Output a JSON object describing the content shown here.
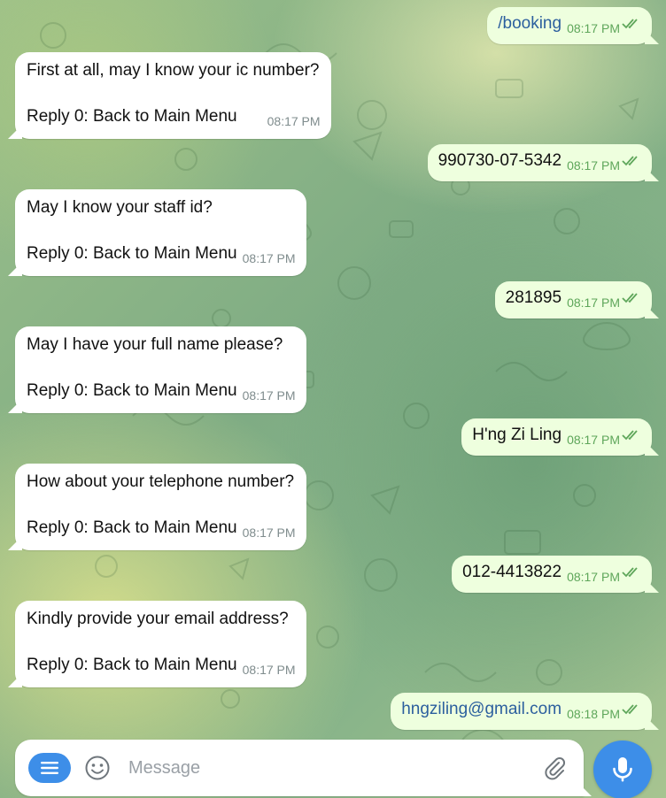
{
  "colors": {
    "incoming_bubble": "#ffffff",
    "outgoing_bubble": "#eeffde",
    "outgoing_time": "#5ea65a",
    "accent": "#3d8ee8"
  },
  "messages": [
    {
      "direction": "out",
      "text": "/booking",
      "time": "08:17 PM",
      "status": "read"
    },
    {
      "direction": "in",
      "text": "First at all, may I know your ic number?",
      "reply_hint": "Reply 0: Back to Main Menu",
      "time": "08:17 PM"
    },
    {
      "direction": "out",
      "text": "990730-07-5342",
      "time": "08:17 PM",
      "status": "read"
    },
    {
      "direction": "in",
      "text": "May I know your staff id?",
      "reply_hint": "Reply 0: Back to Main Menu",
      "time": "08:17 PM"
    },
    {
      "direction": "out",
      "text": "281895",
      "time": "08:17 PM",
      "status": "read"
    },
    {
      "direction": "in",
      "text": "May I have your full name please?",
      "reply_hint": "Reply 0: Back to Main Menu",
      "time": "08:17 PM"
    },
    {
      "direction": "out",
      "text": "H'ng Zi Ling",
      "time": "08:17 PM",
      "status": "read"
    },
    {
      "direction": "in",
      "text": "How about your telephone number?",
      "reply_hint": "Reply 0: Back to Main Menu",
      "time": "08:17 PM"
    },
    {
      "direction": "out",
      "text": "012-4413822",
      "time": "08:17 PM",
      "status": "read"
    },
    {
      "direction": "in",
      "text": "Kindly provide your email address?",
      "reply_hint": "Reply 0: Back to Main Menu",
      "time": "08:17 PM"
    },
    {
      "direction": "out",
      "text": "hngziling@gmail.com",
      "time": "08:18 PM",
      "status": "read"
    }
  ],
  "composer": {
    "placeholder": "Message",
    "value": "",
    "menu_icon": "menu-lines-icon",
    "emoji_icon": "smiley-icon",
    "attach_icon": "paperclip-icon",
    "mic_icon": "microphone-icon"
  }
}
